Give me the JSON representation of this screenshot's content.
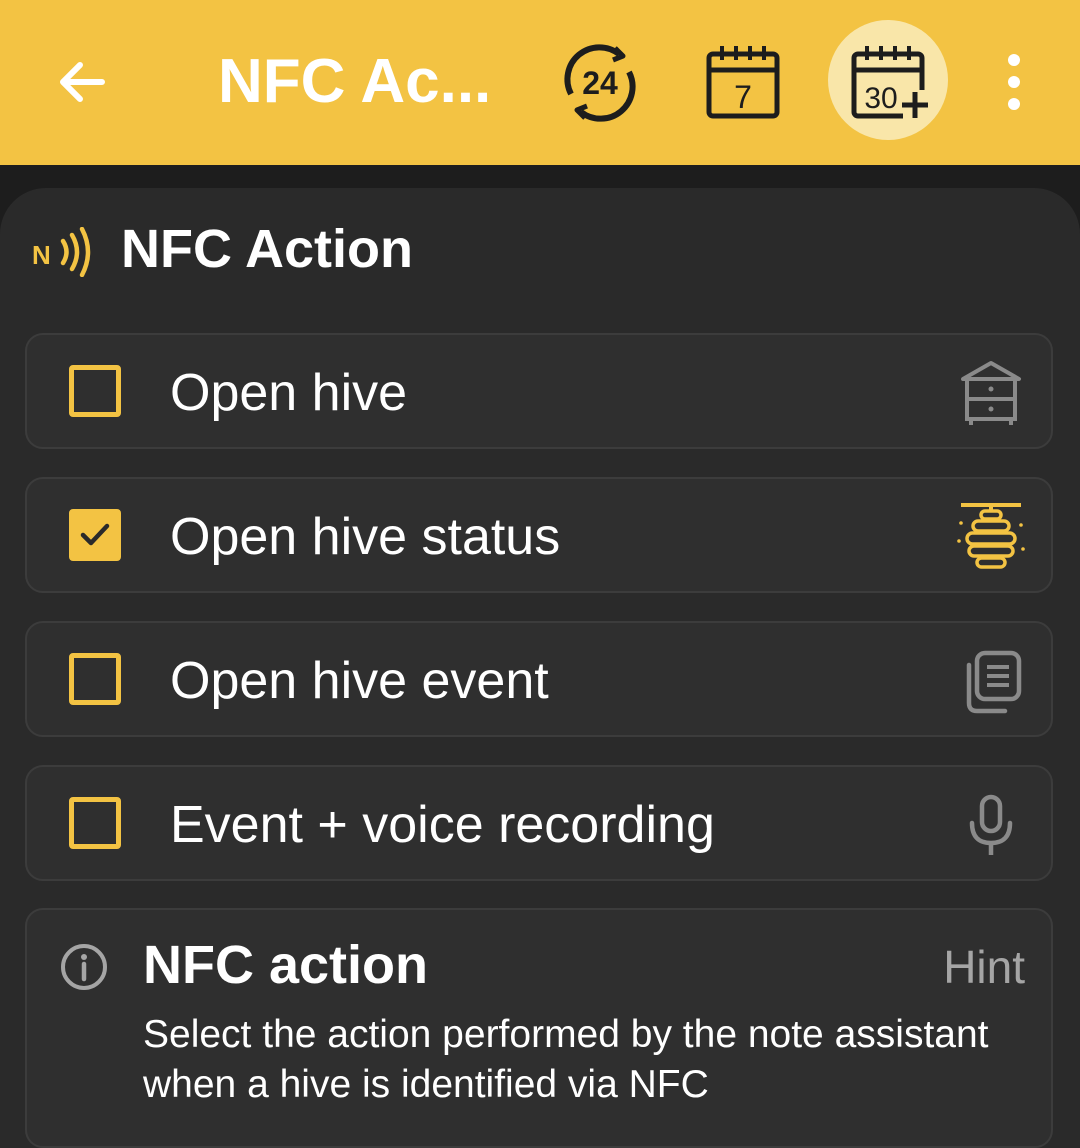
{
  "appbar": {
    "title": "NFC Ac...",
    "actions": [
      {
        "name": "range-24h",
        "label": "24"
      },
      {
        "name": "range-7d",
        "label": "7"
      },
      {
        "name": "range-30d",
        "label": "30",
        "selected": true
      }
    ]
  },
  "section": {
    "title": "NFC Action"
  },
  "options": [
    {
      "label": "Open hive",
      "checked": false,
      "icon": "hive-box-icon"
    },
    {
      "label": "Open hive status",
      "checked": true,
      "icon": "beehive-icon"
    },
    {
      "label": "Open hive event",
      "checked": false,
      "icon": "copy-list-icon"
    },
    {
      "label": "Event + voice recording",
      "checked": false,
      "icon": "microphone-icon"
    }
  ],
  "hint": {
    "title": "NFC action",
    "badge": "Hint",
    "text": "Select the action performed by the note assistant when a hive is identified via NFC"
  },
  "colors": {
    "accent": "#f3c343",
    "background": "#1d1d1d",
    "card": "#2a2a2a",
    "muted_icon": "#8a8a8a"
  }
}
